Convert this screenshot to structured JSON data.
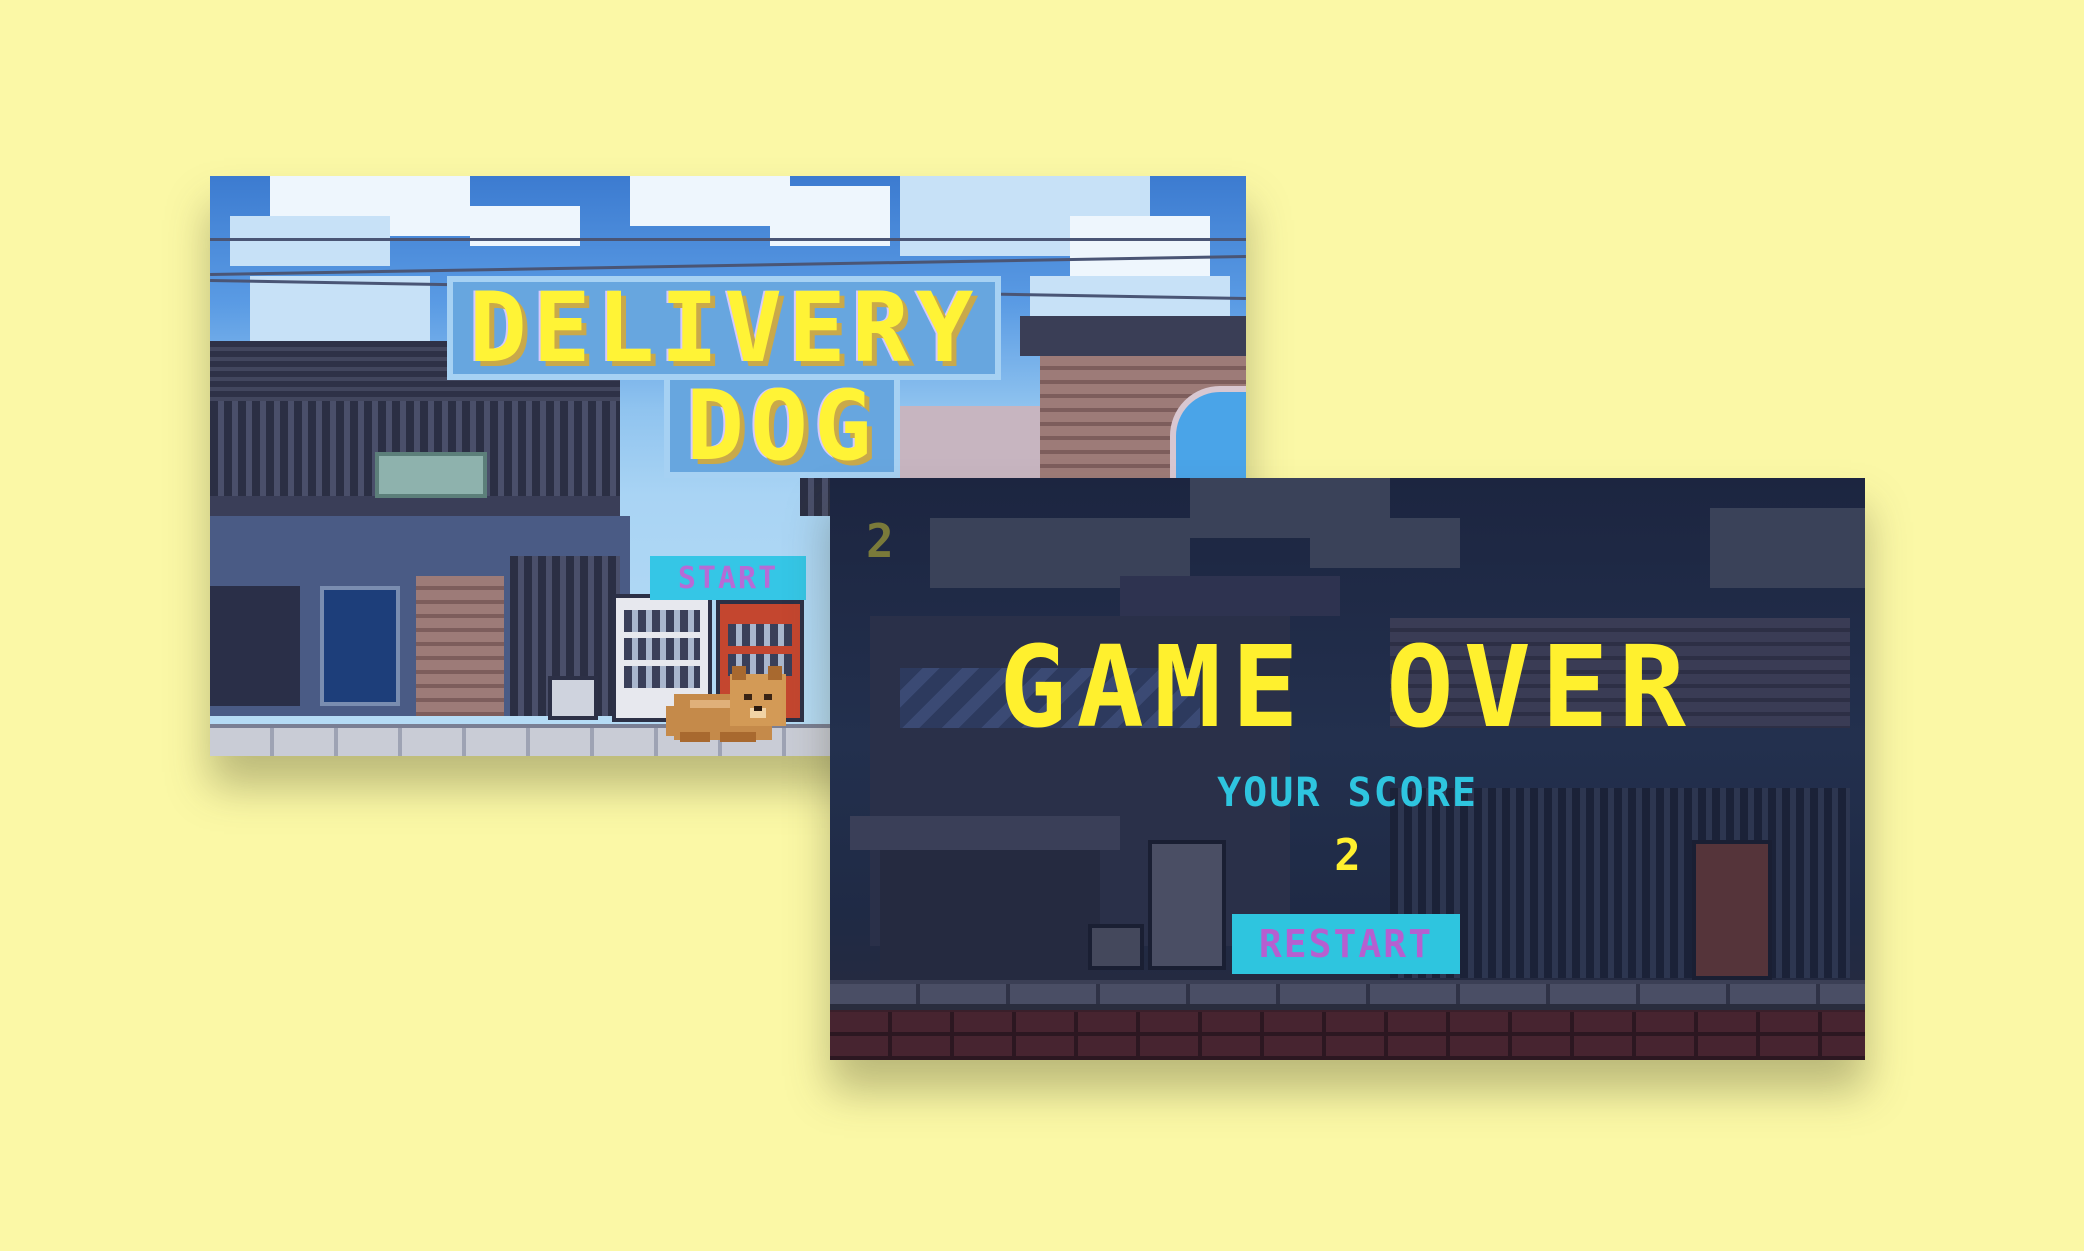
{
  "background_color": "#fbf8a6",
  "start_screen": {
    "title_line1": "DELIVERY",
    "title_line2": "DOG",
    "start_label": "START",
    "title_color": "#fff336",
    "button_color": "#35c6e6",
    "button_text_color": "#b66bd6"
  },
  "game_over_screen": {
    "hud_score": "2",
    "title": "GAME OVER",
    "score_label": "YOUR SCORE",
    "score_value": "2",
    "restart_label": "RESTART",
    "title_color": "#fff02e",
    "label_color": "#2ec5df",
    "button_text_color": "#b65fd0"
  },
  "icons": [
    "dog-sprite-icon",
    "vending-machine-icon",
    "air-conditioner-icon"
  ]
}
